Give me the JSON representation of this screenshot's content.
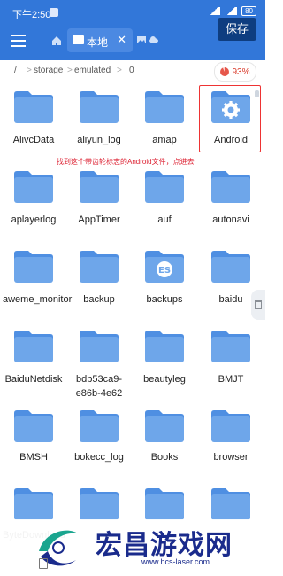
{
  "status_bar": {
    "time": "下午2:50",
    "battery": "80"
  },
  "toolbar": {
    "tab_label": "本地",
    "save_label": "保存"
  },
  "path": {
    "root": "/",
    "seg1": "storage",
    "seg2": "emulated",
    "seg3": "0",
    "sep": ">",
    "storage_percent": "93%"
  },
  "annotation": "找到这个带齿轮标志的Android文件，点进去",
  "folders": [
    "AlivcData",
    "aliyun_log",
    "amap",
    "Android",
    "aplayerlog",
    "AppTimer",
    "auf",
    "autonavi",
    "aweme_monitor",
    "backup",
    "backups",
    "baidu",
    "BaiduNetdisk",
    "bdb53ca9-e86b-4e62",
    "beautyleg",
    "BMJT",
    "BMSH",
    "bokecc_log",
    "Books",
    "browser",
    "ByteDownload",
    "",
    "",
    ""
  ],
  "watermark": {
    "title": "宏昌游戏网",
    "url": "www.hcs-laser.com"
  },
  "colors": {
    "toolbar": "#3277d9",
    "folder": "#6ea6ea",
    "folder_tab": "#4f8fe2",
    "accent_red": "#e33333"
  }
}
